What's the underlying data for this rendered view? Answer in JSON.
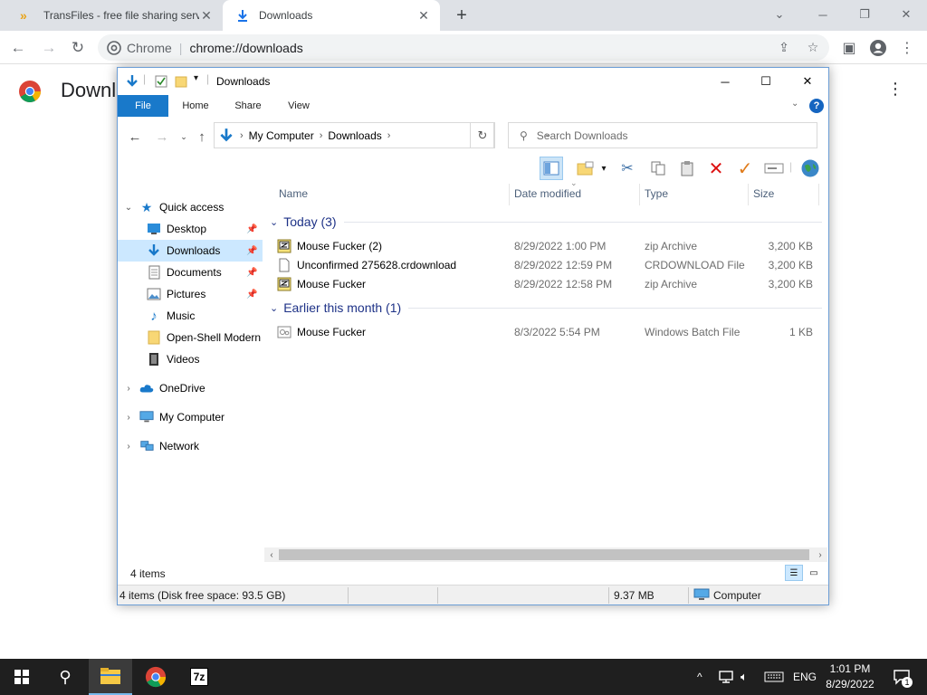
{
  "chrome": {
    "tabs": [
      {
        "title": "TransFiles - free file sharing servi",
        "active": false
      },
      {
        "title": "Downloads",
        "active": true
      }
    ],
    "omnibox": {
      "site": "Chrome",
      "url": "chrome://downloads"
    },
    "page": {
      "title": "Downl"
    }
  },
  "explorer": {
    "title": "Downloads",
    "ribbon_tabs": [
      "File",
      "Home",
      "Share",
      "View"
    ],
    "breadcrumb": [
      "My Computer",
      "Downloads"
    ],
    "search_placeholder": "Search Downloads",
    "nav": [
      {
        "label": "Quick access",
        "icon": "star-icon",
        "level": 0,
        "expander": "v"
      },
      {
        "label": "Desktop",
        "icon": "desktop-icon",
        "level": 1,
        "pinned": true
      },
      {
        "label": "Downloads",
        "icon": "download-arrow-icon",
        "level": 1,
        "pinned": true,
        "selected": true
      },
      {
        "label": "Documents",
        "icon": "document-icon",
        "level": 1,
        "pinned": true
      },
      {
        "label": "Pictures",
        "icon": "pictures-icon",
        "level": 1,
        "pinned": true
      },
      {
        "label": "Music",
        "icon": "music-icon",
        "level": 1
      },
      {
        "label": "Open-Shell Modern",
        "icon": "folder-icon",
        "level": 1
      },
      {
        "label": "Videos",
        "icon": "video-icon",
        "level": 1
      },
      {
        "label": "OneDrive",
        "icon": "cloud-icon",
        "level": 0,
        "expander": ">"
      },
      {
        "label": "My Computer",
        "icon": "computer-icon",
        "level": 0,
        "expander": ">"
      },
      {
        "label": "Network",
        "icon": "network-icon",
        "level": 0,
        "expander": ">"
      }
    ],
    "columns": {
      "name": "Name",
      "date": "Date modified",
      "type": "Type",
      "size": "Size"
    },
    "groups": [
      {
        "label": "Today (3)",
        "files": [
          {
            "name": "Mouse Fucker (2)",
            "date": "8/29/2022 1:00 PM",
            "type": "zip Archive",
            "size": "3,200 KB",
            "icon": "zip-icon"
          },
          {
            "name": "Unconfirmed 275628.crdownload",
            "date": "8/29/2022 12:59 PM",
            "type": "CRDOWNLOAD File",
            "size": "3,200 KB",
            "icon": "blank-file-icon"
          },
          {
            "name": "Mouse Fucker",
            "date": "8/29/2022 12:58 PM",
            "type": "zip Archive",
            "size": "3,200 KB",
            "icon": "zip-icon"
          }
        ]
      },
      {
        "label": "Earlier this month (1)",
        "files": [
          {
            "name": "Mouse Fucker",
            "date": "8/3/2022 5:54 PM",
            "type": "Windows Batch File",
            "size": "1 KB",
            "icon": "batch-file-icon"
          }
        ]
      }
    ],
    "status": {
      "item_count": "4 items"
    },
    "details_bar": {
      "summary": "4 items (Disk free space: 93.5 GB)",
      "size": "9.37 MB",
      "location": "Computer"
    }
  },
  "taskbar": {
    "language": "ENG",
    "time": "1:01 PM",
    "date": "8/29/2022",
    "notification_count": "1",
    "sevenzip_label": "7z"
  }
}
